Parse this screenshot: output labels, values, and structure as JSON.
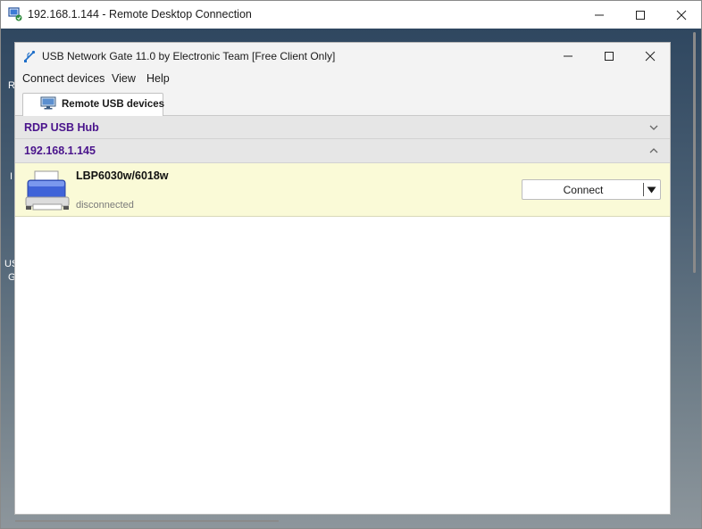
{
  "rdp": {
    "title": "192.168.1.144 - Remote Desktop Connection",
    "icon": "remote-desktop-icon"
  },
  "desktop": {
    "fragments": [
      "R",
      "I",
      "US",
      "G"
    ]
  },
  "app": {
    "title": "USB Network Gate 11.0 by Electronic Team [Free Client Only]",
    "icon": "usb-icon",
    "menu": [
      "Connect devices",
      "View",
      "Help"
    ],
    "tab": {
      "label": "Remote USB devices",
      "icon": "monitor-icon"
    },
    "groups": [
      {
        "label": "RDP USB Hub",
        "expanded": false
      },
      {
        "label": "192.168.1.145",
        "expanded": true
      }
    ],
    "device": {
      "name": "LBP6030w/6018w",
      "status": "disconnected",
      "icon": "printer-icon",
      "action": "Connect"
    }
  },
  "colors": {
    "group_text": "#4a148c",
    "device_row_bg": "#fafad7"
  }
}
